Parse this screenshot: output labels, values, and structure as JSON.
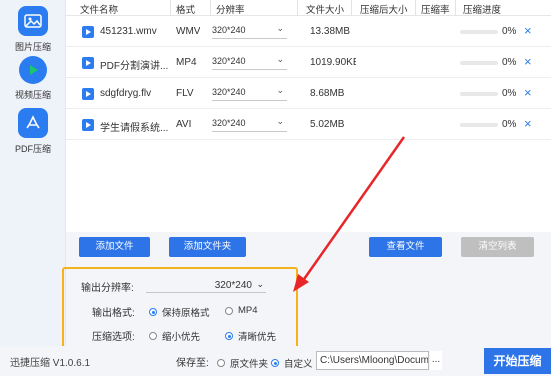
{
  "sidebar": {
    "items": [
      {
        "label": "图片压缩",
        "icon": "image-icon",
        "color": "#2b7cf0"
      },
      {
        "label": "视频压缩",
        "icon": "play-icon",
        "color": "#2b7cf0"
      },
      {
        "label": "PDF压缩",
        "icon": "pdf-icon",
        "color": "#2b7cf0"
      }
    ]
  },
  "table": {
    "headers": [
      "文件名称",
      "格式",
      "分辨率",
      "文件大小",
      "压缩后大小",
      "压缩率",
      "压缩进度"
    ],
    "rows": [
      {
        "name": "451231.wmv",
        "format": "WMV",
        "resolution": "320*240",
        "size": "13.38MB",
        "progress": "0%",
        "progress_value": 0
      },
      {
        "name": "PDF分割演讲...",
        "format": "MP4",
        "resolution": "320*240",
        "size": "1019.90KE",
        "progress": "0%",
        "progress_value": 0
      },
      {
        "name": "sdgfdryg.flv",
        "format": "FLV",
        "resolution": "320*240",
        "size": "8.68MB",
        "progress": "0%",
        "progress_value": 0
      },
      {
        "name": "学生请假系统...",
        "format": "AVI",
        "resolution": "320*240",
        "size": "5.02MB",
        "progress": "0%",
        "progress_value": 0
      }
    ]
  },
  "buttons": {
    "add_file": "添加文件",
    "add_folder": "添加文件夹",
    "view_files": "查看文件",
    "clear_list": "清空列表"
  },
  "settings": {
    "resolution_label": "输出分辨率:",
    "resolution_value": "320*240",
    "format_label": "输出格式:",
    "format_options": [
      "保持原格式",
      "MP4"
    ],
    "format_selected": "保持原格式",
    "compress_label": "压缩选项:",
    "compress_options": [
      "缩小优先",
      "清晰优先"
    ],
    "compress_selected": "清晰优先"
  },
  "footer": {
    "version": "迅捷压缩 V1.0.6.1",
    "save_to": "保存至:",
    "save_options": [
      "原文件夹",
      "自定义"
    ],
    "save_selected": "自定义",
    "path": "C:\\Users\\Mloong\\Docume",
    "browse": "...",
    "start": "开始压缩"
  },
  "colors": {
    "accent": "#2d74e8",
    "highlight_border": "#f5b21a",
    "arrow": "#e8262a"
  }
}
